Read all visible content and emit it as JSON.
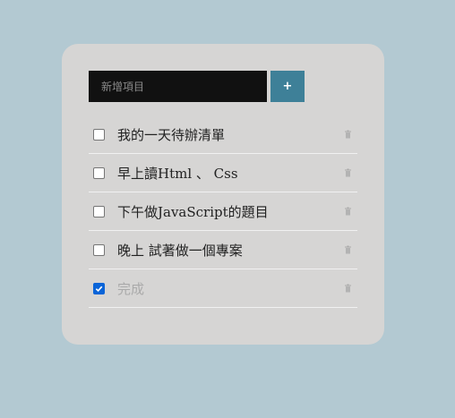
{
  "todo": {
    "input_placeholder": "新增項目",
    "add_label": "+",
    "items": [
      {
        "text": "我的一天待辦清單",
        "checked": false
      },
      {
        "text": "早上讀Html 、 Css",
        "checked": false
      },
      {
        "text": "下午做JavaScript的題目",
        "checked": false
      },
      {
        "text": "晚上 試著做一個專案",
        "checked": false
      },
      {
        "text": "完成",
        "checked": true
      }
    ]
  },
  "colors": {
    "background": "#b3c9d2",
    "card": "#d6d5d4",
    "input": "#111111",
    "accent": "#3e8098",
    "checkbox_checked": "#0a64d8"
  },
  "icons": {
    "delete": "trash-icon",
    "add": "plus"
  }
}
